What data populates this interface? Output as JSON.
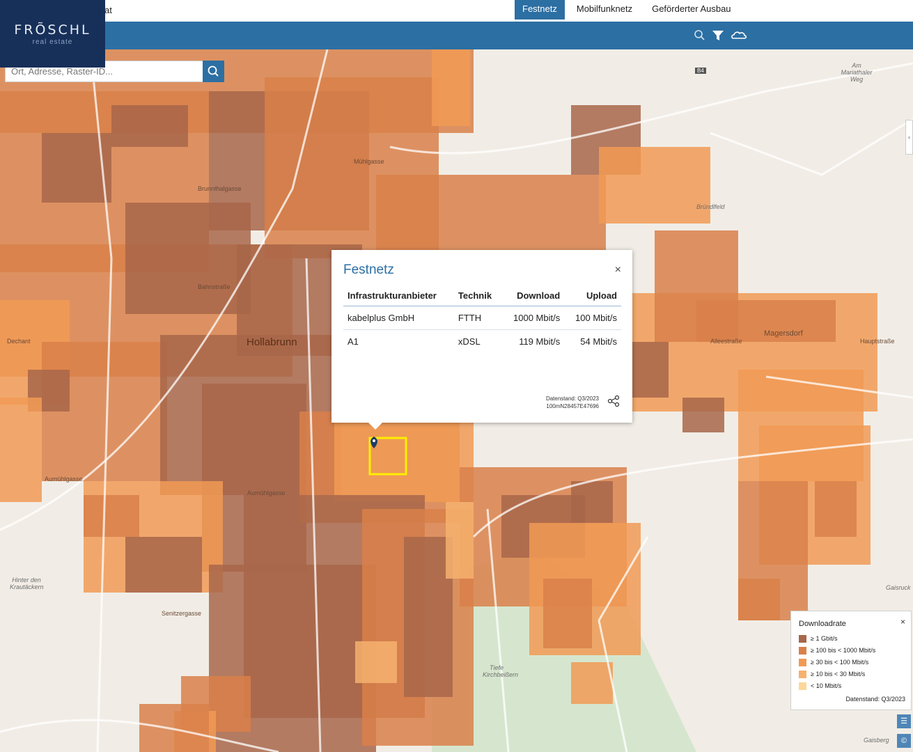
{
  "site": {
    "title_partial": "at"
  },
  "logo": {
    "brand": "FRÕSCHL",
    "sub": "real estate"
  },
  "tabs": [
    {
      "label": "Festnetz",
      "active": true
    },
    {
      "label": "Mobilfunknetz",
      "active": false
    },
    {
      "label": "Geförderter Ausbau",
      "active": false
    }
  ],
  "toolbar": {
    "icons": [
      "search-icon",
      "filter-icon",
      "cloud-icon"
    ]
  },
  "search": {
    "placeholder": "Ort, Adresse, Raster-ID..."
  },
  "colors": {
    "nav_blue": "#2c6fa3",
    "logo_navy": "#17305a",
    "rate_1gbit": "#a8664a",
    "rate_100_1000": "#d9804a",
    "rate_30_100": "#f19a55",
    "rate_10_30": "#f6b26e",
    "rate_lt10": "#fdd79a",
    "selected_cell": "#ffee00"
  },
  "popup": {
    "title": "Festnetz",
    "close": "×",
    "headers": [
      "Infrastrukturanbieter",
      "Technik",
      "Download",
      "Upload"
    ],
    "rows": [
      [
        "kabelplus GmbH",
        "FTTH",
        "1000 Mbit/s",
        "100 Mbit/s"
      ],
      [
        "A1",
        "xDSL",
        "119 Mbit/s",
        "54 Mbit/s"
      ]
    ],
    "footer_line1": "Datenstand: Q3/2023",
    "footer_line2": "100mN28457E47696"
  },
  "legend": {
    "title": "Downloadrate",
    "close": "×",
    "items": [
      {
        "label": "≥ 1 Gbit/s",
        "color": "#a8664a"
      },
      {
        "label": "≥ 100 bis < 1000 Mbit/s",
        "color": "#d9804a"
      },
      {
        "label": "≥ 30 bis < 100 Mbit/s",
        "color": "#f19a55"
      },
      {
        "label": "≥ 10 bis < 30 Mbit/s",
        "color": "#f6b26e"
      },
      {
        "label": "< 10 Mbit/s",
        "color": "#fdd79a"
      }
    ],
    "footer": "Datenstand: Q3/2023"
  },
  "map_labels": {
    "town": "Hollabrunn",
    "magersdorf": "Magersdorf",
    "muehlgasse": "Mühlgasse",
    "brunnthalgasse": "Brunnthalgasse",
    "bahnstrasse": "Bahnstraße",
    "amuehlgasse": "Aumühlgasse",
    "aumuehlgasse2": "Aumühlgasse",
    "senitzergasse": "Senitzergasse",
    "alleestrasse": "Alleestraße",
    "hauptstrasse": "Hauptstraße",
    "dechant": "Dechant",
    "tiefe": "Tiefe Kirchbeißern",
    "hinter": "Hinter den Krautäckern",
    "mariathaler": "Am Mariathaler Weg",
    "gaisruck": "Gaisruck",
    "gaisberg": "Gaisberg",
    "bruendlfeld": "Bründlfeld",
    "b4": "B4"
  }
}
